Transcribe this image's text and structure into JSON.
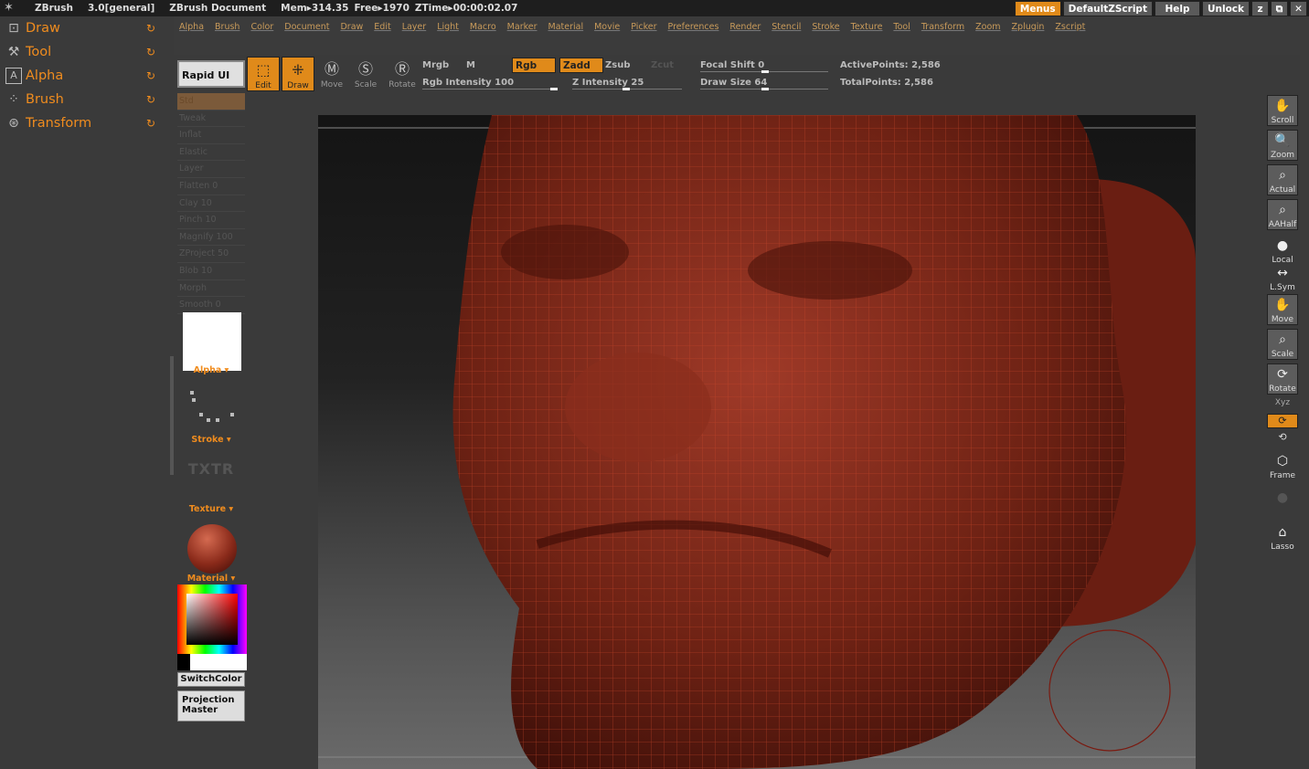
{
  "titlebar": {
    "app": "ZBrush",
    "version": "3.0[general]",
    "document": "ZBrush Document",
    "mem": "Mem▸314.35",
    "free": "Free▸1970",
    "ztime": "ZTime▸00:00:02.07",
    "menus_btn": "Menus",
    "script_btn": "DefaultZScript",
    "help_btn": "Help",
    "unlock_btn": "Unlock",
    "min_btn": "z",
    "restore_btn": "⧉",
    "close_btn": "✕"
  },
  "leftpanel": {
    "items": [
      {
        "label": "Draw",
        "icon": "draw-icon"
      },
      {
        "label": "Tool",
        "icon": "tool-icon"
      },
      {
        "label": "Alpha",
        "icon": "alpha-icon"
      },
      {
        "label": "Brush",
        "icon": "brush-icon"
      },
      {
        "label": "Transform",
        "icon": "transform-icon"
      }
    ]
  },
  "menubar": [
    "Alpha",
    "Brush",
    "Color",
    "Document",
    "Draw",
    "Edit",
    "Layer",
    "Light",
    "Macro",
    "Marker",
    "Material",
    "Movie",
    "Picker",
    "Preferences",
    "Render",
    "Stencil",
    "Stroke",
    "Texture",
    "Tool",
    "Transform",
    "Zoom",
    "Zplugin",
    "Zscript"
  ],
  "toolbar": {
    "rapid": "Rapid UI",
    "edit": "Edit",
    "draw": "Draw",
    "move": "Move",
    "scale": "Scale",
    "rotate": "Rotate",
    "mrgb": "Mrgb",
    "m": "M",
    "rgb": "Rgb",
    "zadd": "Zadd",
    "zsub": "Zsub",
    "zcut": "Zcut",
    "rgb_intensity": "Rgb Intensity 100",
    "z_intensity": "Z Intensity 25",
    "focal_shift": "Focal Shift 0",
    "draw_size": "Draw Size 64",
    "active_points": "ActivePoints: 2,586",
    "total_points": "TotalPoints: 2,586"
  },
  "brushes": [
    "Std",
    "Tweak",
    "Inflat",
    "Elastic",
    "Layer",
    "Flatten 0",
    "Clay 10",
    "Pinch 10",
    "Magnify 100",
    "ZProject 50",
    "Blob 10",
    "Morph",
    "Smooth 0"
  ],
  "subpanel": {
    "alpha": "Alpha",
    "stroke": "Stroke",
    "txtr": "TXTR",
    "texture": "Texture",
    "material": "Material",
    "switch_color": "SwitchColor",
    "projection_master": "Projection Master"
  },
  "rightpanel": [
    "Scroll",
    "Zoom",
    "Actual",
    "AAHalf",
    "Local",
    "L.Sym",
    "Move",
    "Scale",
    "Rotate",
    "Frame",
    "Lasso"
  ],
  "rightpanel_xyz": "Xyz",
  "colors": {
    "accent": "#e08a1a",
    "menu_text": "#c89a5a",
    "skin": "#8a2a1a"
  }
}
